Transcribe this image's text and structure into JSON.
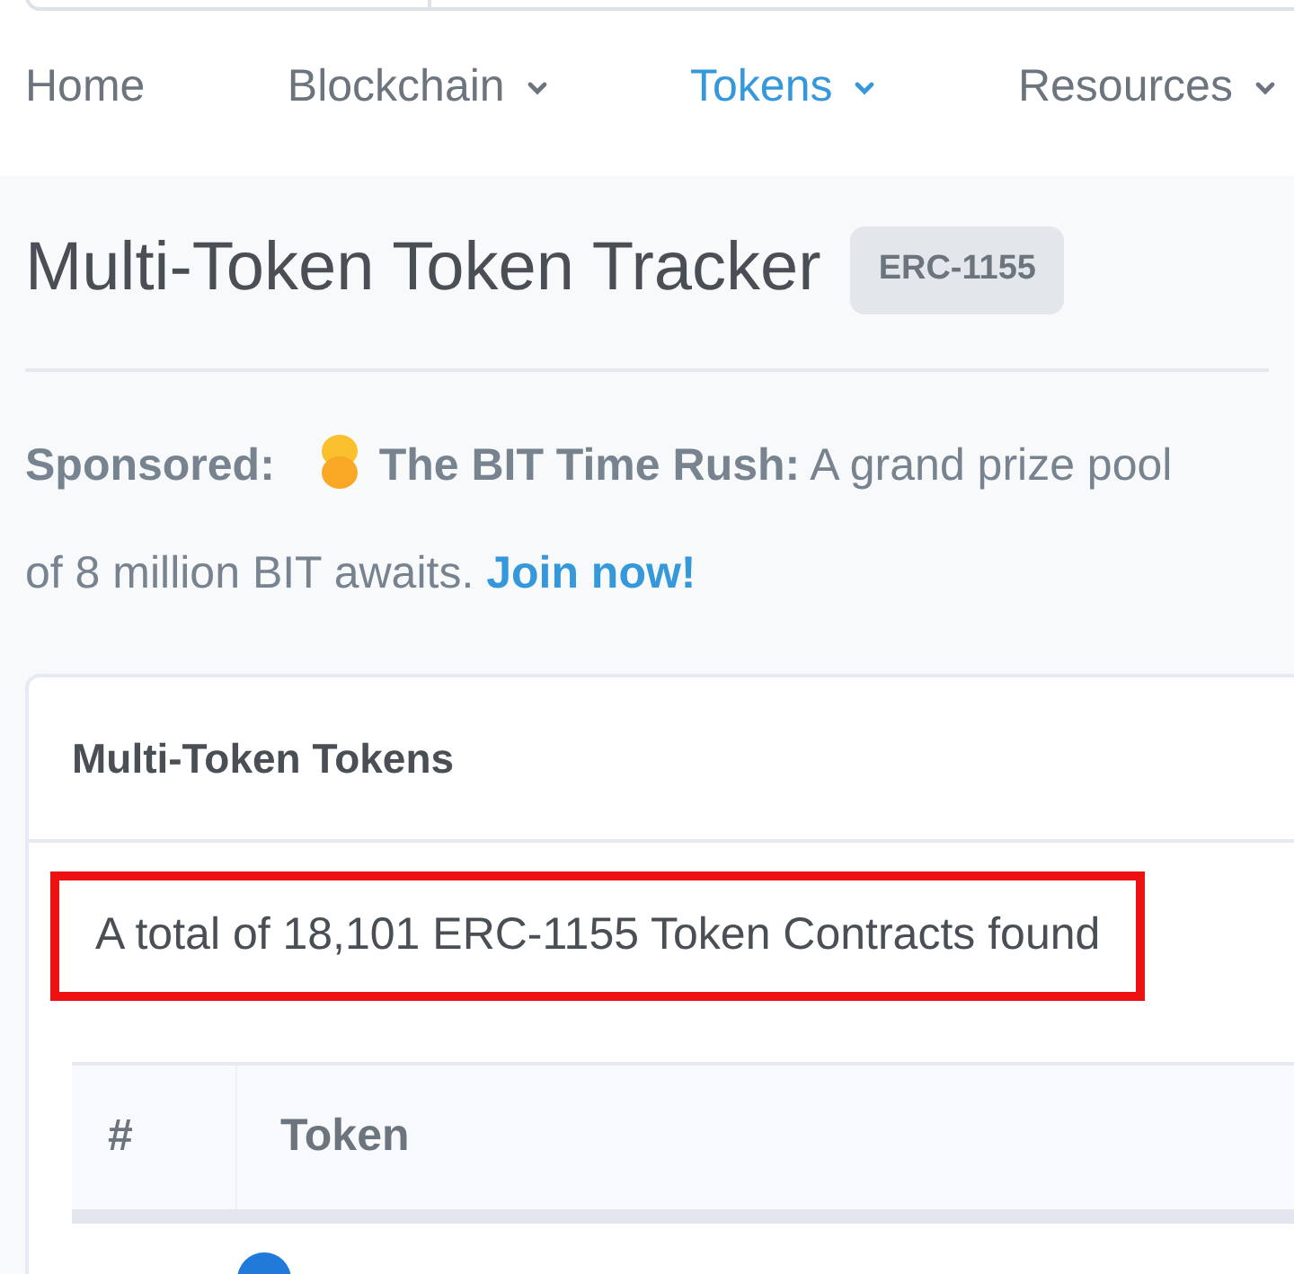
{
  "nav": [
    {
      "label": "Home",
      "dropdown": false,
      "selected": false
    },
    {
      "label": "Blockchain",
      "dropdown": true,
      "selected": false
    },
    {
      "label": "Tokens",
      "dropdown": true,
      "selected": true
    },
    {
      "label": "Resources",
      "dropdown": true,
      "selected": false
    }
  ],
  "page": {
    "title": "Multi-Token Token Tracker",
    "badge": "ERC-1155"
  },
  "sponsored": {
    "label": "Sponsored:",
    "text": "**The BIT Time Rush:** A grand prize pool of 8 million BIT awaits.",
    "link": "Join now!"
  },
  "card": {
    "title": "Multi-Token Tokens",
    "summary": "A total of 18,101 ERC-1155 Token Contracts found",
    "highlighted": true,
    "columns": [
      "#",
      "Token"
    ]
  }
}
